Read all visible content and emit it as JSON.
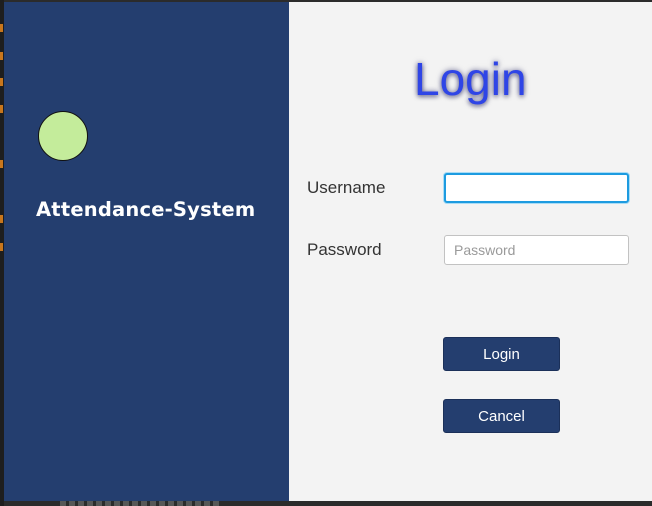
{
  "app": {
    "title": "Attendance-System"
  },
  "login_form": {
    "heading": "Login",
    "username_label": "Username",
    "username_value": "",
    "username_placeholder": "",
    "password_label": "Password",
    "password_value": "",
    "password_placeholder": "Password",
    "login_button": "Login",
    "cancel_button": "Cancel"
  },
  "colors": {
    "sidebar": "#243e6f",
    "accent_heading": "#2f45e6",
    "logo_fill": "#c4ec9b",
    "focus_border": "#1d9be0",
    "button_bg": "#243e6f"
  },
  "icons": {
    "logo": "logo-circle-icon"
  }
}
